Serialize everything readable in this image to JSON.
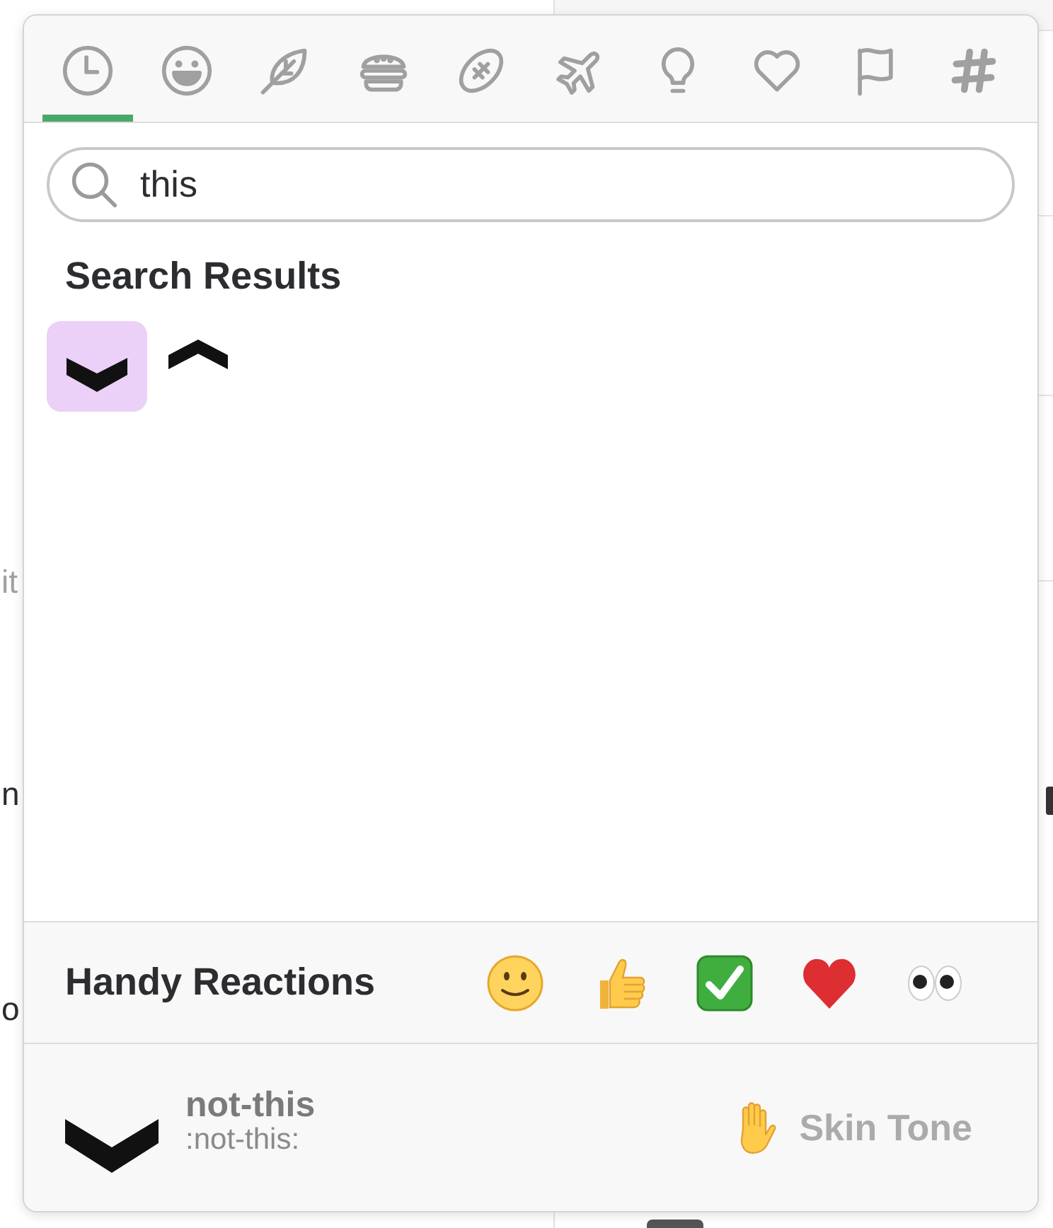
{
  "background": {
    "fragments": [
      {
        "text": "it",
        "dimmed": true
      },
      {
        "text": "n",
        "dimmed": false
      },
      {
        "text": "o",
        "dimmed": false
      }
    ]
  },
  "emoji_picker": {
    "category_tabs": [
      {
        "selected": true
      },
      {
        "selected": false
      },
      {
        "selected": false
      },
      {
        "selected": false
      },
      {
        "selected": false
      },
      {
        "selected": false
      },
      {
        "selected": false
      },
      {
        "selected": false
      },
      {
        "selected": false
      },
      {
        "selected": false
      }
    ],
    "search": {
      "value": "this"
    },
    "results_heading": "Search Results",
    "results": [
      {
        "selected": true
      },
      {
        "selected": false
      }
    ],
    "handy_reactions": {
      "label": "Handy Reactions"
    },
    "preview": {
      "name": "not-this",
      "shortcode": ":not-this:"
    },
    "skin_tone": {
      "label": "Skin Tone"
    }
  }
}
